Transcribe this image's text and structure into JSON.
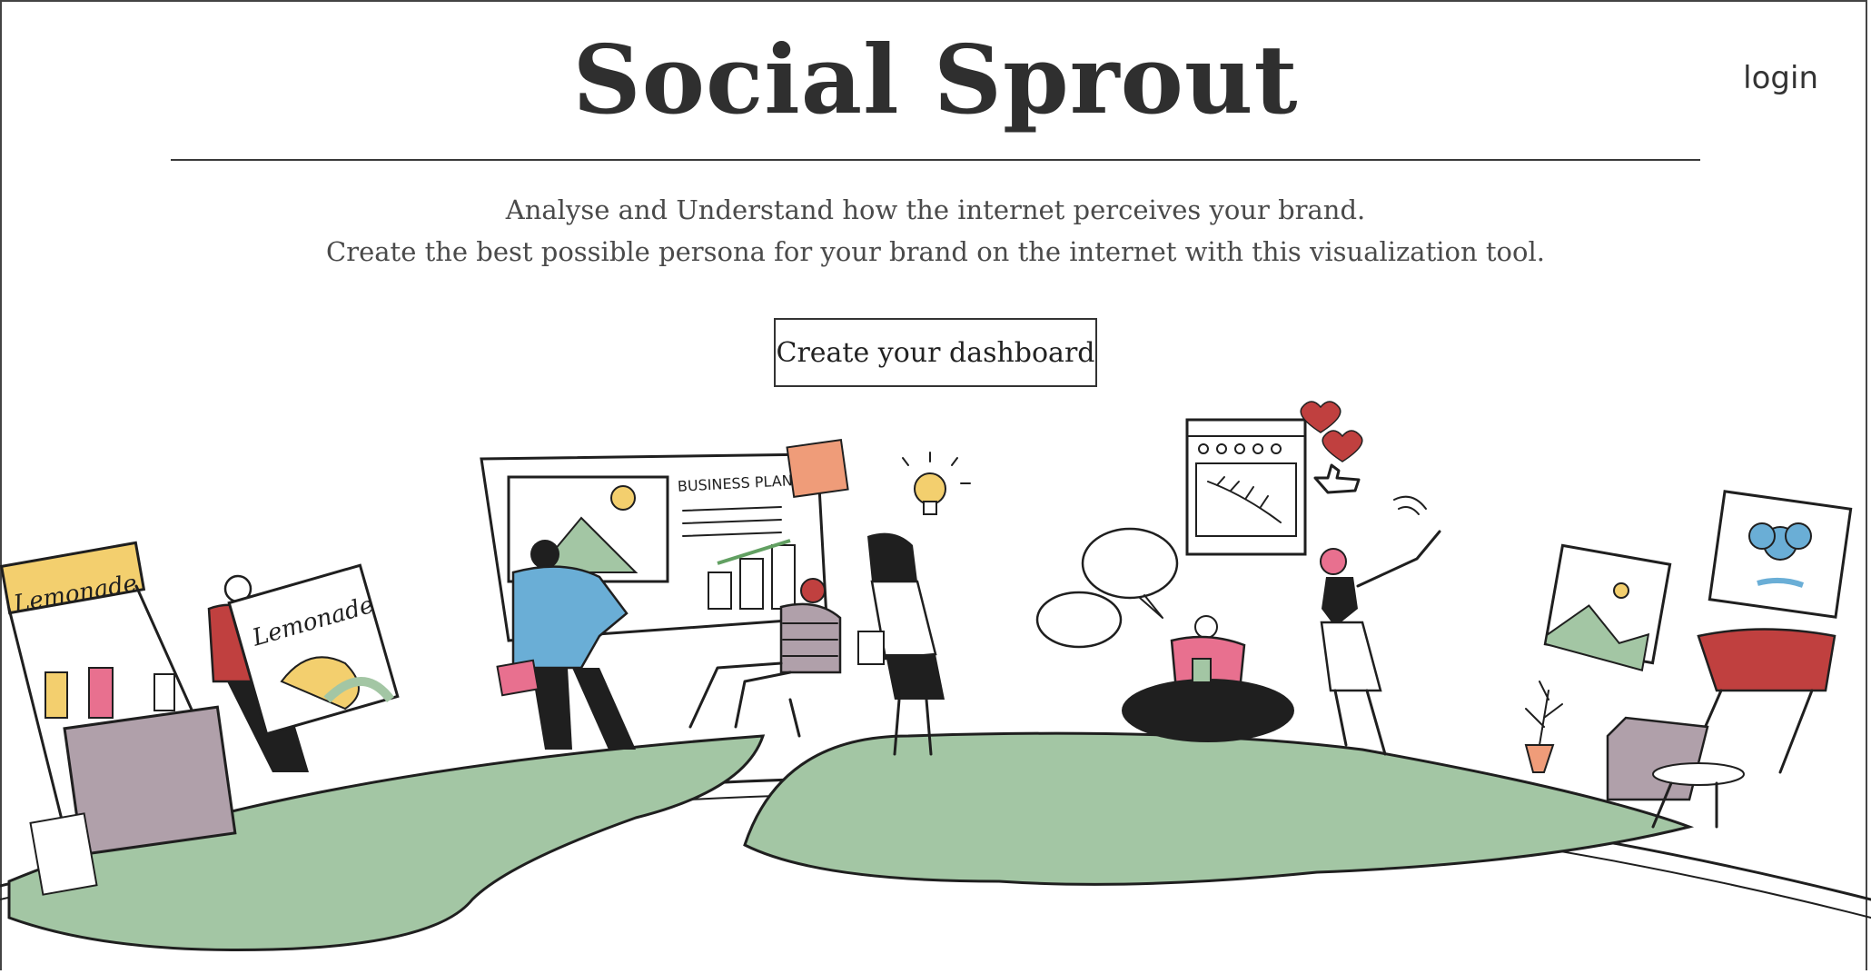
{
  "header": {
    "title": "Social Sprout",
    "login_label": "login"
  },
  "hero": {
    "tagline_line1": "Analyse and Understand how the internet perceives your brand.",
    "tagline_line2": "Create the best possible persona for your brand on the internet with this visualization tool.",
    "cta_label": "Create your dashboard"
  },
  "illustration": {
    "lemonade_sign": "Lemonade",
    "lemonade_poster": "Lemonade",
    "business_plan": "BUSINESS PLAN",
    "colors": {
      "green": "#a3c6a4",
      "blue": "#6aaed6",
      "red": "#c0403f",
      "pink": "#e8708f",
      "yellow": "#f3cf6e",
      "purple": "#b0a0aa",
      "orange": "#ef9c79"
    }
  }
}
